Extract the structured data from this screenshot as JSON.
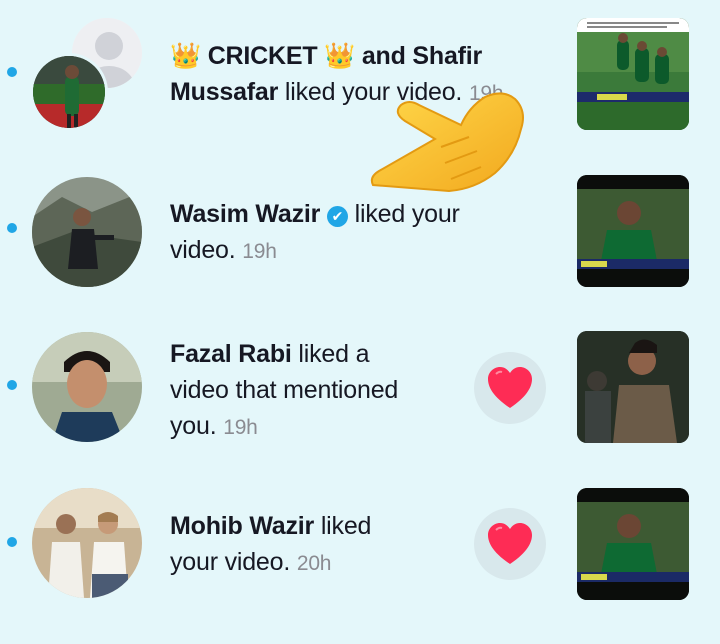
{
  "notifications": [
    {
      "name_line1": "CRICKET",
      "name_mid": "and Shafir",
      "name2": "Mussafar",
      "action": "liked your video.",
      "time": "19h",
      "crown_icon": "👑"
    },
    {
      "name": "Wasim Wazir",
      "verified_icon": "✔",
      "action_line1": "liked your",
      "action_line2": "video.",
      "time": "19h"
    },
    {
      "name": "Fazal Rabi",
      "action_line1": "liked a",
      "action_line2": "video that mentioned",
      "action_line3": "you.",
      "time": "19h",
      "heart_icon": "❤"
    },
    {
      "name": "Mohib Wazir",
      "action_line1": "liked",
      "action_line2": "your video.",
      "time": "20h",
      "heart_icon": "❤"
    }
  ],
  "colors": {
    "background": "#e4f7fa",
    "unread_dot": "#20a6e6",
    "verified": "#20a6e6",
    "heart": "#fe2c55",
    "timestamp": "#8a8b91"
  },
  "icons": {
    "pointing_hand": "pointing-hand-icon",
    "crown": "crown-icon",
    "heart": "heart-icon",
    "verified": "verified-badge-icon"
  }
}
